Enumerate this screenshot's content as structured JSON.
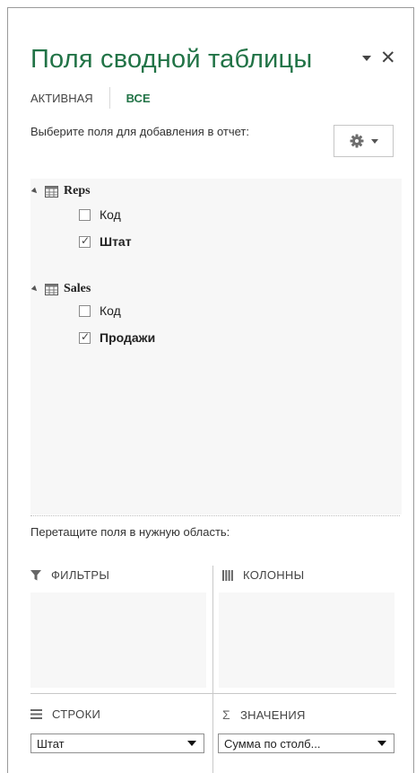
{
  "panel": {
    "title": "Поля сводной таблицы",
    "icons": {
      "options": "chevron-down-icon",
      "close": "close-icon"
    },
    "close_glyph": "✕"
  },
  "tabs": [
    {
      "label": "АКТИВНАЯ",
      "selected": false
    },
    {
      "label": "ВСЕ",
      "selected": true
    }
  ],
  "choose_fields_label": "Выберите поля для добавления в отчет:",
  "tables": [
    {
      "name": "Reps",
      "expanded": true,
      "fields": [
        {
          "label": "Код",
          "checked": false
        },
        {
          "label": "Штат",
          "checked": true
        }
      ]
    },
    {
      "name": "Sales",
      "expanded": true,
      "fields": [
        {
          "label": "Код",
          "checked": false
        },
        {
          "label": "Продажи",
          "checked": true
        }
      ]
    }
  ],
  "drag_label": "Перетащите поля в нужную область:",
  "areas": {
    "filters": {
      "label": "ФИЛЬТРЫ",
      "icon": "filter-icon"
    },
    "columns": {
      "label": "КОЛОННЫ",
      "icon": "columns-icon"
    },
    "rows": {
      "label": "СТРОКИ",
      "icon": "rows-icon",
      "item": "Штат"
    },
    "values": {
      "label": "ЗНАЧЕНИЯ",
      "icon": "sigma-icon",
      "glyph": "Σ",
      "item": "Сумма по столб..."
    }
  },
  "colors": {
    "accent": "#217346",
    "text": "#262626",
    "border": "#9a9a9a",
    "panel_bg": "#f7f7f7"
  }
}
